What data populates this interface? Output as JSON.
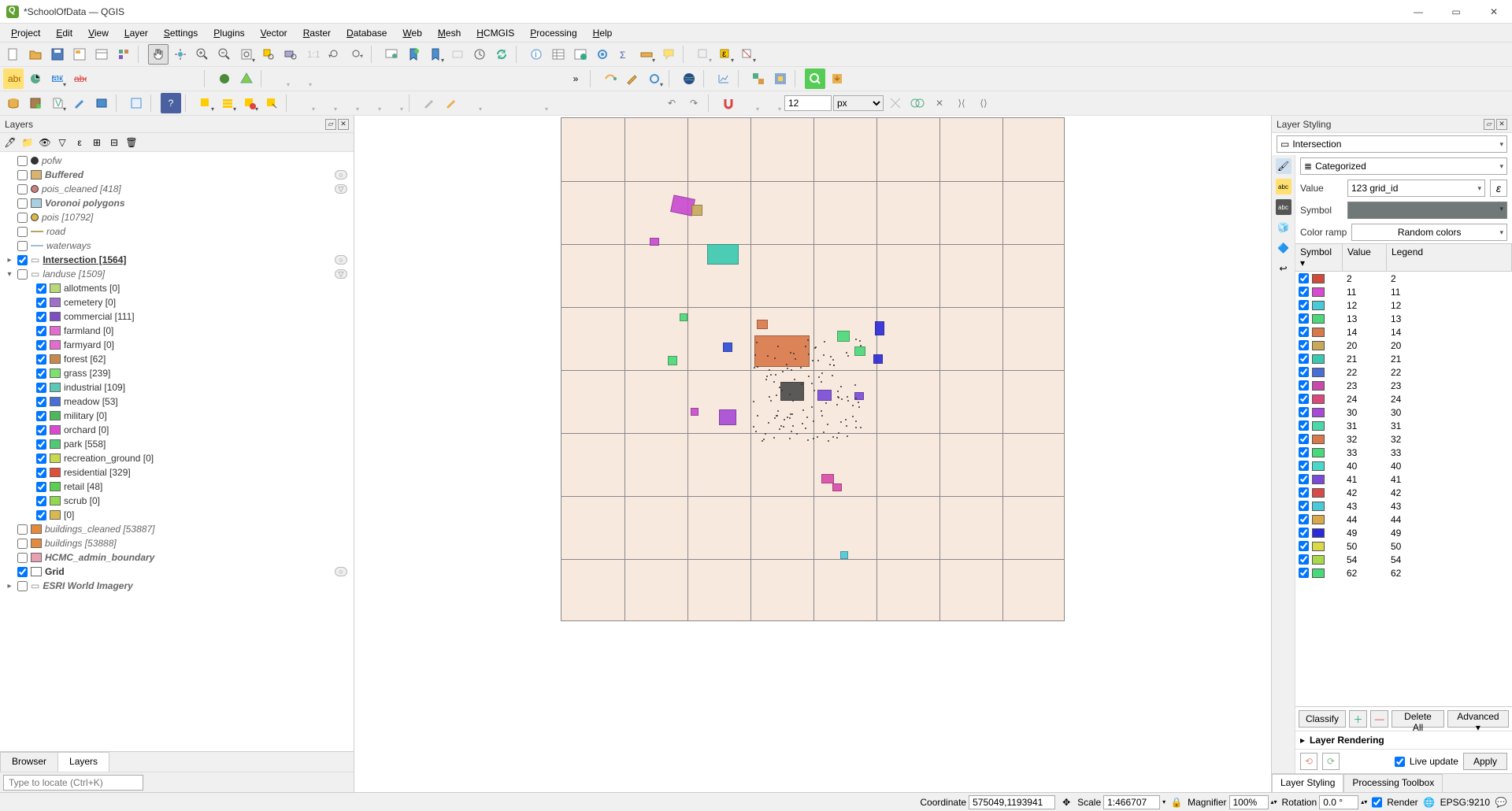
{
  "window": {
    "title": "*SchoolOfData — QGIS"
  },
  "menu": [
    "Project",
    "Edit",
    "View",
    "Layer",
    "Settings",
    "Plugins",
    "Vector",
    "Raster",
    "Database",
    "Web",
    "Mesh",
    "HCMGIS",
    "Processing",
    "Help"
  ],
  "layers_panel": {
    "title": "Layers",
    "items": [
      {
        "checked": false,
        "sym": "point",
        "color": "#333",
        "name": "pofw",
        "italic": true
      },
      {
        "checked": false,
        "sym": "fill",
        "color": "#d9b36c",
        "name": "Buffered",
        "italic": true,
        "bold": true,
        "action": "o"
      },
      {
        "checked": false,
        "sym": "point",
        "color": "#c98080",
        "name": "pois_cleaned [418]",
        "italic": true,
        "action": "filter"
      },
      {
        "checked": false,
        "sym": "fill",
        "color": "#a9d0e0",
        "name": "Voronoi polygons",
        "italic": true,
        "bold": true
      },
      {
        "checked": false,
        "sym": "point",
        "color": "#d9b84a",
        "name": "pois [10792]",
        "italic": true
      },
      {
        "checked": false,
        "sym": "line",
        "color": "#c0a060",
        "name": "road",
        "italic": true
      },
      {
        "checked": false,
        "sym": "line",
        "color": "#a0c0d0",
        "name": "waterways",
        "italic": true
      },
      {
        "expander": "▸",
        "checked": true,
        "sym": "icon",
        "name": "Intersection [1564]",
        "active": true,
        "action": "o"
      },
      {
        "expander": "▾",
        "checked": false,
        "sym": "icon",
        "name": "landuse [1509]",
        "italic": true,
        "action": "filter"
      }
    ],
    "landuse_sub": [
      {
        "color": "#b8d977",
        "name": "allotments [0]"
      },
      {
        "color": "#9f6fc9",
        "name": "cemetery [0]"
      },
      {
        "color": "#7e4fc2",
        "name": "commercial [111]"
      },
      {
        "color": "#e36ccf",
        "name": "farmland [0]"
      },
      {
        "color": "#e36ccf",
        "name": "farmyard [0]"
      },
      {
        "color": "#c88a4b",
        "name": "forest [62]"
      },
      {
        "color": "#7de070",
        "name": "grass [239]"
      },
      {
        "color": "#5cc9b8",
        "name": "industrial [109]"
      },
      {
        "color": "#4a6fd4",
        "name": "meadow [53]"
      },
      {
        "color": "#4bb85c",
        "name": "military [0]"
      },
      {
        "color": "#d94ad1",
        "name": "orchard [0]"
      },
      {
        "color": "#4fc977",
        "name": "park [558]"
      },
      {
        "color": "#c9d94f",
        "name": "recreation_ground [0]"
      },
      {
        "color": "#e05038",
        "name": "residential [329]"
      },
      {
        "color": "#5ccf4f",
        "name": "retail [48]"
      },
      {
        "color": "#91d94f",
        "name": "scrub [0]"
      },
      {
        "color": "#d9b84f",
        "name": " [0]"
      }
    ],
    "tail": [
      {
        "checked": false,
        "sym": "fill",
        "color": "#e38a3c",
        "name": "buildings_cleaned [53887]",
        "italic": true
      },
      {
        "checked": false,
        "sym": "fill",
        "color": "#e38a3c",
        "name": "buildings [53888]",
        "italic": true
      },
      {
        "checked": false,
        "sym": "fill",
        "color": "#e8a0b0",
        "name": "HCMC_admin_boundary",
        "italic": true,
        "bold": true
      },
      {
        "checked": true,
        "sym": "fill",
        "color": "#fff",
        "name": "Grid",
        "bold": true,
        "action": "o"
      },
      {
        "expander": "▸",
        "checked": false,
        "sym": "icon",
        "name": "ESRI World Imagery",
        "italic": true,
        "bold": true
      }
    ],
    "tabs": [
      "Browser",
      "Layers"
    ],
    "active_tab": 1,
    "locator_placeholder": "Type to locate (Ctrl+K)"
  },
  "styling": {
    "title": "Layer Styling",
    "layer": "Intersection",
    "renderer": "Categorized",
    "value_label": "Value",
    "value_field": "123 grid_id",
    "symbol_label": "Symbol",
    "ramp_label": "Color ramp",
    "ramp_value": "Random colors",
    "headers": {
      "sym": "Symbol",
      "val": "Value",
      "leg": "Legend"
    },
    "categories": [
      {
        "c": "#d14a3a",
        "v": "2"
      },
      {
        "c": "#d94ad1",
        "v": "11"
      },
      {
        "c": "#4ac9d9",
        "v": "12"
      },
      {
        "c": "#4ad97a",
        "v": "13"
      },
      {
        "c": "#d9784a",
        "v": "14"
      },
      {
        "c": "#c8a85a",
        "v": "20"
      },
      {
        "c": "#3ac9b0",
        "v": "21"
      },
      {
        "c": "#4a6fd4",
        "v": "22"
      },
      {
        "c": "#c94aa8",
        "v": "23"
      },
      {
        "c": "#d94a7a",
        "v": "24"
      },
      {
        "c": "#a84ad9",
        "v": "30"
      },
      {
        "c": "#4ad9a8",
        "v": "31"
      },
      {
        "c": "#d9784a",
        "v": "32"
      },
      {
        "c": "#4ad97a",
        "v": "33"
      },
      {
        "c": "#4ad9c8",
        "v": "40"
      },
      {
        "c": "#7a4ad9",
        "v": "41"
      },
      {
        "c": "#d94a4a",
        "v": "42"
      },
      {
        "c": "#4ac9d9",
        "v": "43"
      },
      {
        "c": "#d9a84a",
        "v": "44"
      },
      {
        "c": "#2a2ad9",
        "v": "49"
      },
      {
        "c": "#d9d94a",
        "v": "50"
      },
      {
        "c": "#a8d94a",
        "v": "54"
      },
      {
        "c": "#4ad97a",
        "v": "62"
      }
    ],
    "classify": "Classify",
    "add": "+",
    "remove": "−",
    "delete_all": "Delete All",
    "advanced": "Advanced",
    "rendering": "Layer Rendering",
    "live_update": "Live update",
    "apply": "Apply",
    "tabs": [
      "Layer Styling",
      "Processing Toolbox"
    ],
    "active_tab": 0
  },
  "status": {
    "coord_label": "Coordinate",
    "coord": "575049,1193941",
    "scale_label": "Scale",
    "scale": "1:466707",
    "mag_label": "Magnifier",
    "mag": "100%",
    "rot_label": "Rotation",
    "rot": "0.0 °",
    "render": "Render",
    "crs": "EPSG:9210"
  },
  "toolbar3": {
    "size": "12",
    "unit": "px"
  }
}
